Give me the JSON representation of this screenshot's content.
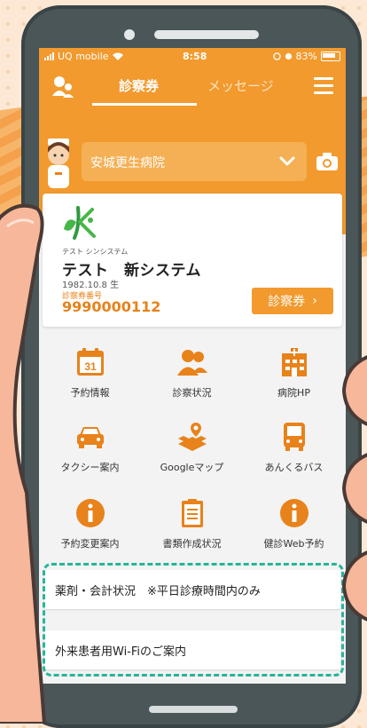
{
  "status_bar": {
    "carrier": "UQ mobile",
    "time": "8:58",
    "battery": "83%"
  },
  "header": {
    "tab_active": "診察券",
    "tab_inactive": "メッセージ"
  },
  "hospital": {
    "name": "安城更生病院"
  },
  "card": {
    "kana": "テスト シンシステム",
    "name": "テスト　新システム",
    "birth": "1982.10.8 生",
    "number_label": "診察券番号",
    "number": "9990000112",
    "button_label": "診察券"
  },
  "grid": [
    {
      "label": "予約情報",
      "icon": "calendar-icon",
      "day": "31"
    },
    {
      "label": "診察状況",
      "icon": "people-icon"
    },
    {
      "label": "病院HP",
      "icon": "hospital-icon"
    },
    {
      "label": "タクシー案内",
      "icon": "taxi-icon"
    },
    {
      "label": "Googleマップ",
      "icon": "map-icon"
    },
    {
      "label": "あんくるバス",
      "icon": "bus-icon"
    },
    {
      "label": "予約変更案内",
      "icon": "info-icon"
    },
    {
      "label": "書類作成状況",
      "icon": "document-icon"
    },
    {
      "label": "健診Web予約",
      "icon": "info-icon"
    }
  ],
  "list": [
    {
      "label": "薬剤・会計状況　※平日診療時間内のみ"
    },
    {
      "label": "外来患者用Wi-Fiのご案内"
    }
  ],
  "colors": {
    "brand_orange": "#f29a2e",
    "highlight_teal": "#27b59a"
  }
}
